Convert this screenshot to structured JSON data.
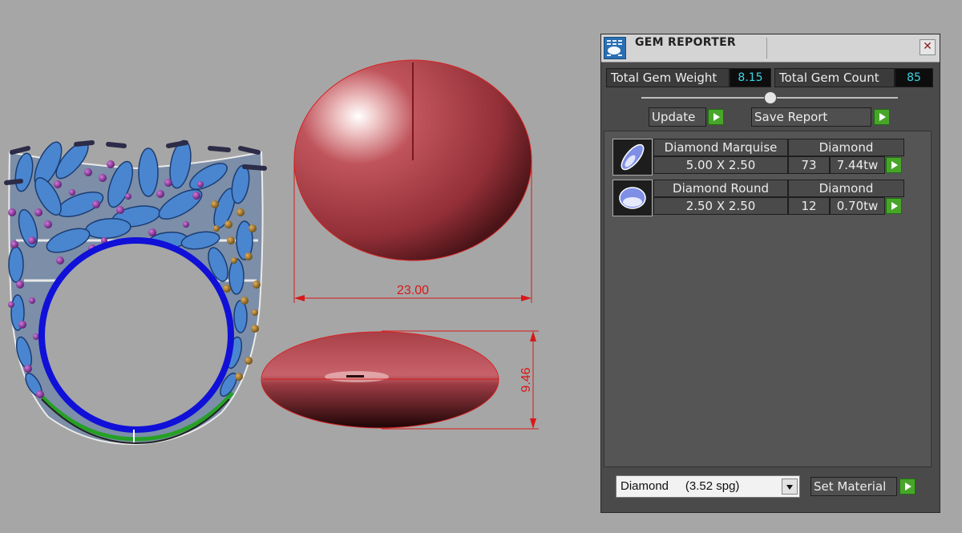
{
  "viewport": {
    "dimension_width": "23.00",
    "dimension_height": "9.46"
  },
  "panel": {
    "title": "GEM REPORTER",
    "close_symbol": "✕",
    "total_weight_label": "Total Gem Weight",
    "total_weight_value": "8.15",
    "total_count_label": "Total Gem Count",
    "total_count_value": "85",
    "update_label": "Update",
    "save_report_label": "Save Report",
    "gems": [
      {
        "name": "Diamond Marquise",
        "material": "Diamond",
        "size": "5.00 X 2.50",
        "count": "73",
        "weight": "7.44tw",
        "icon": "marquise-gem-icon"
      },
      {
        "name": "Diamond Round",
        "material": "Diamond",
        "size": "2.50 X 2.50",
        "count": "12",
        "weight": "0.70tw",
        "icon": "round-gem-icon"
      }
    ],
    "material_select_value": "Diamond     (3.52 spg)",
    "set_material_label": "Set Material",
    "colors": {
      "play_button": "#48a52a",
      "value_text": "#3bd6e6",
      "dimension": "#d81818",
      "gem_blue": "#4a86d0",
      "ring_band": "#1010d8",
      "stone_red": "#b6464e"
    }
  }
}
